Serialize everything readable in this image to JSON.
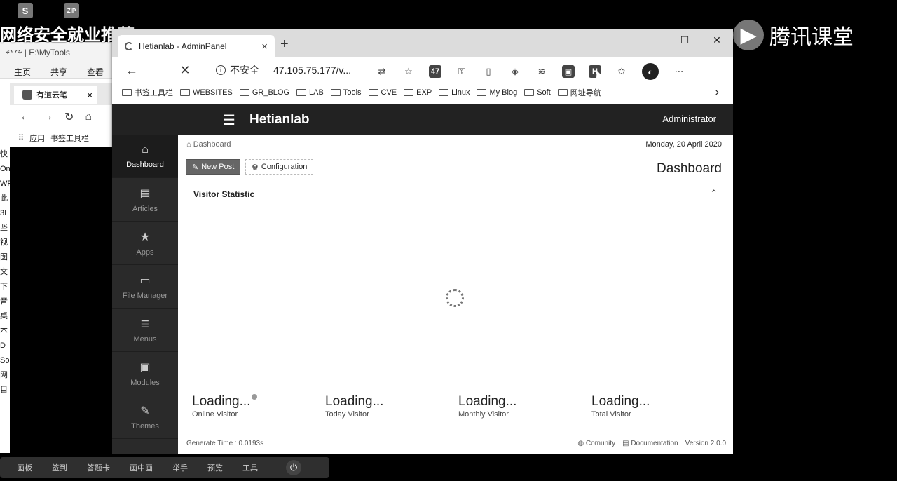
{
  "desktop": {
    "icons": [
      {
        "label": "S"
      },
      {
        "label": "ZIP"
      }
    ],
    "overlay_title": "网络安全就业推荐",
    "tencent_brand": "腾讯课堂"
  },
  "explorer": {
    "quick_access": "↶ ↷ | E:\\MyTools",
    "tabs": [
      "主页",
      "共享",
      "查看"
    ],
    "side_chars": [
      "快",
      "On",
      "WP",
      "此",
      "3I",
      "坚",
      "视",
      "图",
      "文",
      "下",
      "音",
      "桌",
      "本",
      "D",
      "So",
      "网",
      "",
      "目"
    ],
    "inner_tab": "有道云笔",
    "inner_bm_apps": "应用",
    "inner_bm_toolbar": "书签工具栏"
  },
  "browser": {
    "tab_title": "Hetianlab - AdminPanel",
    "tab_close": "×",
    "new_tab": "+",
    "controls": {
      "minimize": "—",
      "maximize": "☐",
      "close": "✕"
    },
    "back": "←",
    "stop": "✕",
    "security_label": "不安全",
    "url": "47.105.75.177/v...",
    "menu": "⋯",
    "bookmarks": [
      {
        "label": "书签工具栏"
      },
      {
        "label": "WEBSITES"
      },
      {
        "label": "GR_BLOG"
      },
      {
        "label": "LAB"
      },
      {
        "label": "Tools"
      },
      {
        "label": "CVE"
      },
      {
        "label": "EXP"
      },
      {
        "label": "Linux"
      },
      {
        "label": "My Blog"
      },
      {
        "label": "Soft"
      },
      {
        "label": "网址导航"
      }
    ],
    "bookmarks_more": "›"
  },
  "app": {
    "brand": "Hetianlab",
    "user": "Administrator",
    "sidebar": [
      {
        "label": "Dashboard",
        "icon": "⌂"
      },
      {
        "label": "Articles",
        "icon": "▤"
      },
      {
        "label": "Apps",
        "icon": "★"
      },
      {
        "label": "File Manager",
        "icon": "▭"
      },
      {
        "label": "Menus",
        "icon": "≣"
      },
      {
        "label": "Modules",
        "icon": "▣"
      },
      {
        "label": "Themes",
        "icon": "✎"
      }
    ],
    "breadcrumb": "Dashboard",
    "date": "Monday, 20 April 2020",
    "new_post": "New Post",
    "configuration": "Configuration",
    "page_title": "Dashboard",
    "panel_title": "Visitor Statistic",
    "collapse_icon": "⌃",
    "stats": [
      {
        "value": "Loading...",
        "label": "Online Visitor"
      },
      {
        "value": "Loading...",
        "label": "Today Visitor"
      },
      {
        "value": "Loading...",
        "label": "Monthly Visitor"
      },
      {
        "value": "Loading...",
        "label": "Total Visitor"
      }
    ],
    "footer": {
      "generate": "Generate Time : 0.0193s",
      "community": "Comunity",
      "documentation": "Documentation",
      "version": "Version  2.0.0"
    }
  },
  "taskbar": {
    "items": [
      "画板",
      "签到",
      "答题卡",
      "画中画",
      "举手",
      "预览",
      "工具"
    ],
    "power": "⏻"
  }
}
